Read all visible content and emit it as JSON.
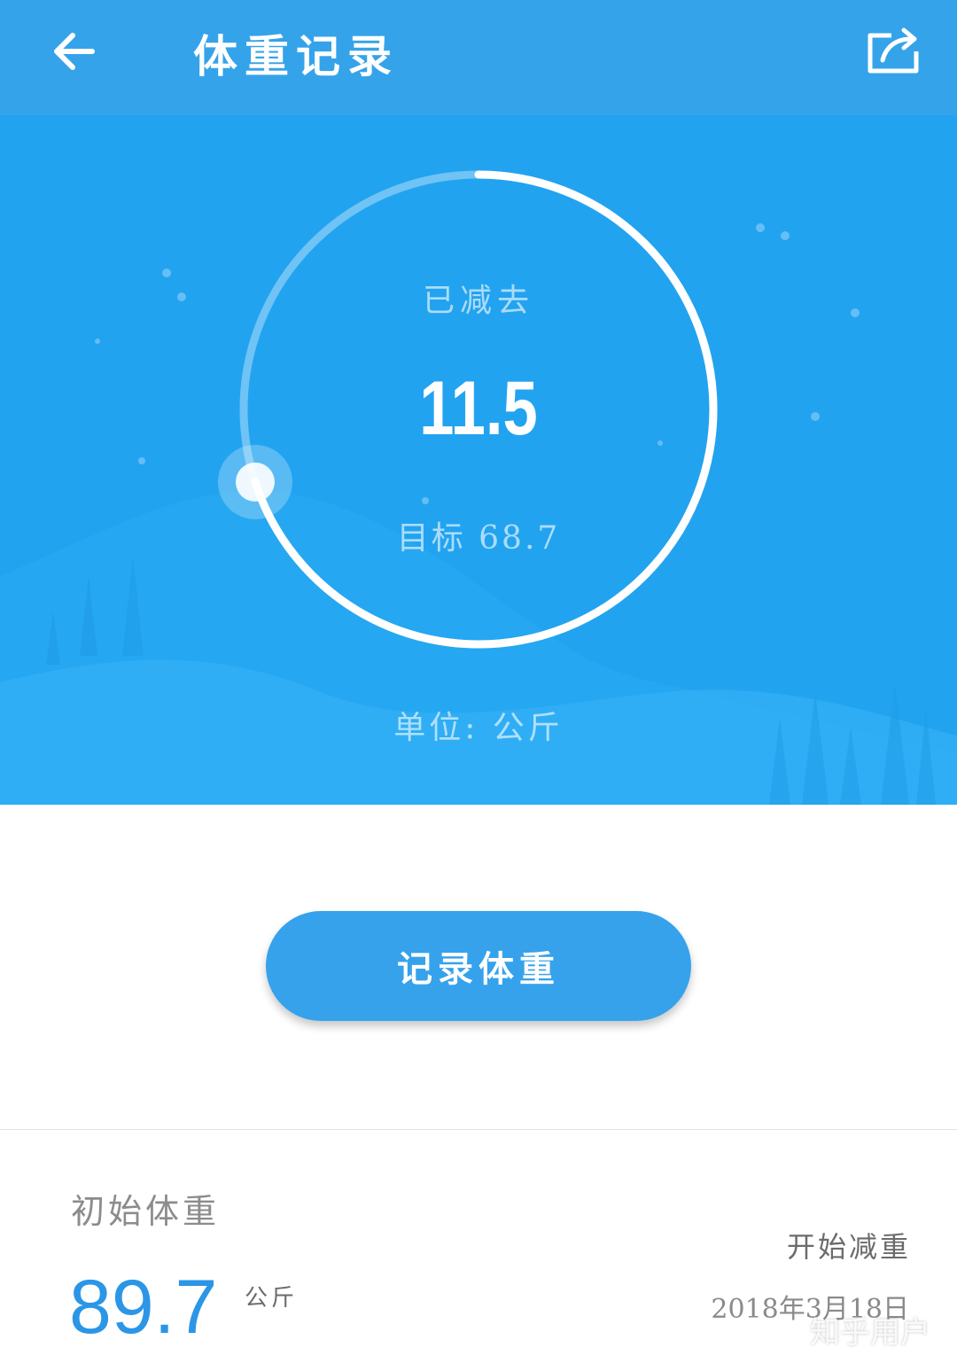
{
  "app_bar": {
    "title": "体重记录",
    "back_icon": "arrow-left-icon",
    "share_icon": "share-icon"
  },
  "progress": {
    "lost_label": "已减去",
    "lost_value": "11.5",
    "goal_label": "目标",
    "goal_value": "68.7",
    "unit_text": "单位: 公斤",
    "ring_fraction": 0.7
  },
  "actions": {
    "record_weight_label": "记录体重"
  },
  "summary": {
    "initial_label": "初始体重",
    "initial_value": "89.7",
    "initial_unit": "公斤",
    "start_label": "开始减重",
    "start_date": "2018年3月18日"
  },
  "watermark": "知乎用户",
  "colors": {
    "app_bar": "#35a3ea",
    "hero": "#22a3f0",
    "accent": "#2b96e6",
    "button": "#36a2ec"
  }
}
